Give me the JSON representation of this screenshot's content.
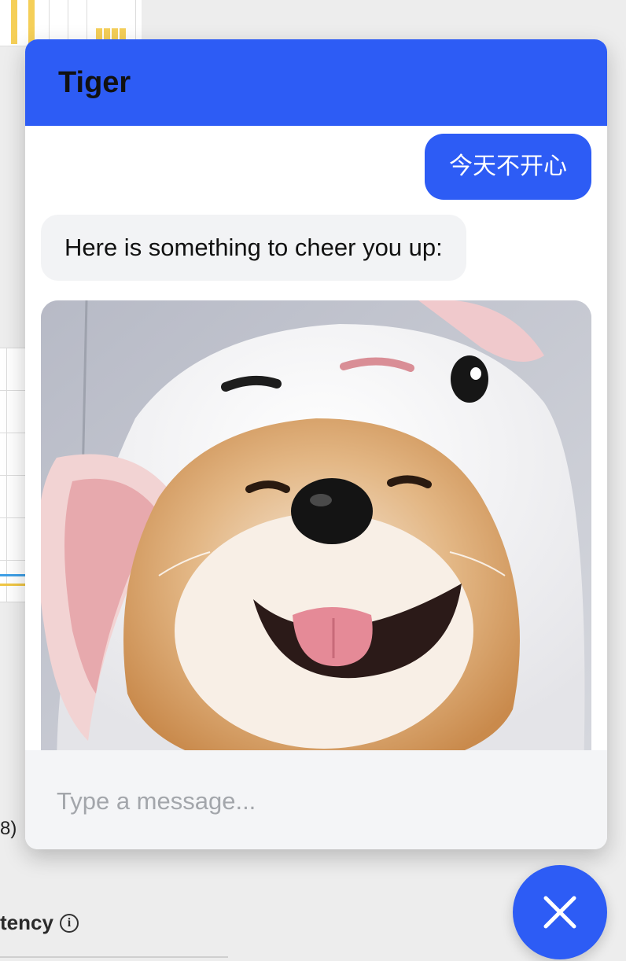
{
  "chat": {
    "title": "Tiger",
    "messages": [
      {
        "role": "user",
        "text": "今天不开心"
      },
      {
        "role": "bot",
        "text": "Here is something to cheer you up:"
      }
    ],
    "input_placeholder": "Type a message...",
    "close_icon": "close-icon",
    "image": "shiba-inu-in-bunny-hood"
  },
  "background": {
    "text_fragment": "8)",
    "section_heading": "tency",
    "info_icon_glyph": "i"
  },
  "colors": {
    "accent": "#2d5cf5",
    "bot_bubble": "#f2f3f5",
    "input_bg": "#f4f5f7",
    "chart_yellow": "#f5cf58",
    "chart_blue": "#3f9fe6"
  }
}
